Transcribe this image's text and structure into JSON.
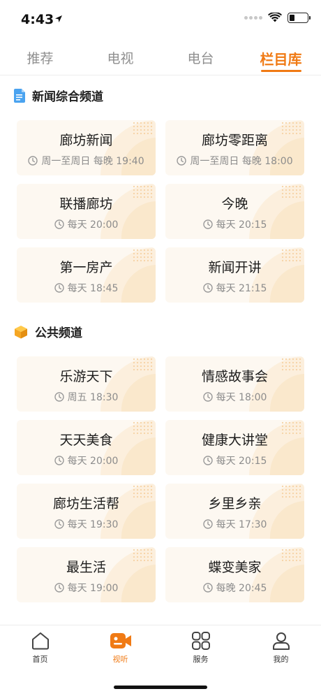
{
  "status_bar": {
    "time": "4:43"
  },
  "top_tabs": [
    {
      "label": "推荐"
    },
    {
      "label": "电视"
    },
    {
      "label": "电台"
    },
    {
      "label": "栏目库",
      "active": true
    }
  ],
  "sections": [
    {
      "title": "新闻综合频道",
      "icon": "document-icon",
      "icon_color": "#4aa3f0",
      "programs": [
        {
          "name": "廊坊新闻",
          "time": "周一至周日 每晚 19:40"
        },
        {
          "name": "廊坊零距离",
          "time": "周一至周日 每晚 18:00"
        },
        {
          "name": "联播廊坊",
          "time": "每天 20:00"
        },
        {
          "name": "今晚",
          "time": "每天 20:15"
        },
        {
          "name": "第一房产",
          "time": "每天 18:45"
        },
        {
          "name": "新闻开讲",
          "time": "每天 21:15"
        }
      ]
    },
    {
      "title": "公共频道",
      "icon": "box-icon",
      "icon_color": "#f5a623",
      "programs": [
        {
          "name": "乐游天下",
          "time": "周五 18:30"
        },
        {
          "name": "情感故事会",
          "time": "每天 18:00"
        },
        {
          "name": "天天美食",
          "time": "每天 20:00"
        },
        {
          "name": "健康大讲堂",
          "time": "每天 20:15"
        },
        {
          "name": "廊坊生活帮",
          "time": "每天 19:30"
        },
        {
          "name": "乡里乡亲",
          "time": "每天 17:30"
        },
        {
          "name": "最生活",
          "time": "每天 19:00"
        },
        {
          "name": "蝶变美家",
          "time": "每晚 20:45"
        }
      ]
    }
  ],
  "bottom_nav": [
    {
      "label": "首页",
      "icon": "home-icon"
    },
    {
      "label": "视听",
      "icon": "video-icon",
      "active": true
    },
    {
      "label": "服务",
      "icon": "grid-icon"
    },
    {
      "label": "我的",
      "icon": "user-icon"
    }
  ],
  "colors": {
    "accent": "#f07a14",
    "card_bg": "#fdf8f1",
    "muted_text": "#8c8c8c"
  }
}
